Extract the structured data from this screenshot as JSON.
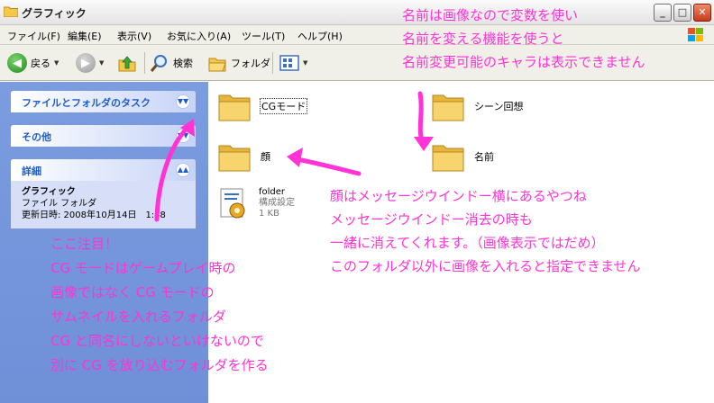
{
  "window": {
    "title": "グラフィック"
  },
  "menu": [
    "ファイル(F)",
    "編集(E)",
    "表示(V)",
    "お気に入り(A)",
    "ツール(T)",
    "ヘルプ(H)"
  ],
  "toolbar": {
    "back_label": "戻る",
    "search_label": "検索",
    "folders_label": "フォルダ"
  },
  "sidebar": {
    "tasks_title": "ファイルとフォルダのタスク",
    "other_title": "その他",
    "details_title": "詳細",
    "details": {
      "name": "グラフィック",
      "type": "ファイル フォルダ",
      "modified": "更新日時: 2008年10月14日　1:48"
    }
  },
  "items": {
    "cg_mode": "CGモード",
    "face": "顔",
    "folder_file": {
      "name": "folder",
      "type": "構成設定",
      "size": "1 KB"
    },
    "scene": "シーン回想",
    "name": "名前"
  },
  "annotations": {
    "top": [
      "名前は画像なので変数を使い",
      "名前を変える機能を使うと",
      "名前変更可能のキャラは表示できません"
    ],
    "middle": [
      "顔はメッセージウインドー横にあるやつね",
      "メッセージウインドー消去の時も",
      "一緒に消えてくれます。（画像表示ではだめ）",
      "このフォルダ以外に画像を入れると指定できません"
    ],
    "bottom": [
      "ここ注目！",
      "CG モードはゲームプレイ時の",
      "画像ではなく CG モードの",
      "サムネイルを入れるフォルダ",
      "CG と同名にしないといけないので",
      "別に CG を放り込むフォルダを作る"
    ]
  },
  "colors": {
    "annotation": "#ff33d6",
    "sidebar_bg": "#7c9ce0",
    "task_header_text": "#215dc6"
  }
}
